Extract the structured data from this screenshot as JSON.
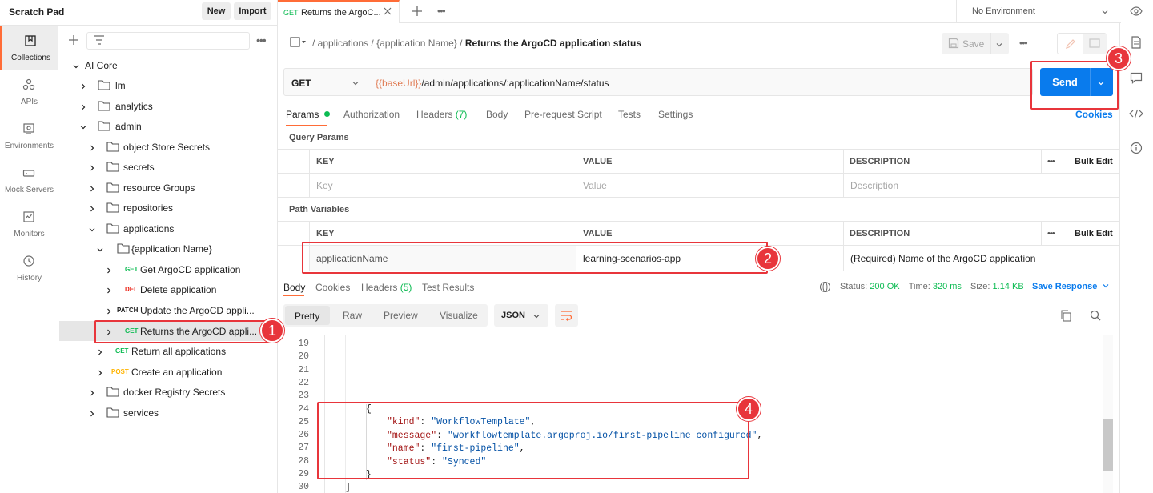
{
  "sidebar_header": {
    "title": "Scratch Pad",
    "new_label": "New",
    "import_label": "Import"
  },
  "rail": [
    {
      "label": "Collections",
      "icon": "collections-icon",
      "active": true
    },
    {
      "label": "APIs",
      "icon": "apis-icon"
    },
    {
      "label": "Environments",
      "icon": "environments-icon"
    },
    {
      "label": "Mock Servers",
      "icon": "mock-servers-icon"
    },
    {
      "label": "Monitors",
      "icon": "monitors-icon"
    },
    {
      "label": "History",
      "icon": "history-icon"
    }
  ],
  "tree": {
    "root": "AI Core",
    "items": [
      {
        "label": "lm"
      },
      {
        "label": "analytics"
      },
      {
        "label": "admin"
      },
      {
        "label": "object Store Secrets"
      },
      {
        "label": "secrets"
      },
      {
        "label": "resource Groups"
      },
      {
        "label": "repositories"
      },
      {
        "label": "applications"
      },
      {
        "label": "{application Name}"
      },
      {
        "method": "GET",
        "label": "Get ArgoCD application"
      },
      {
        "method": "DEL",
        "label": "Delete application"
      },
      {
        "method": "PATCH",
        "label": "Update the ArgoCD appli..."
      },
      {
        "method": "GET",
        "label": "Returns the ArgoCD appli..."
      },
      {
        "method": "GET",
        "label": "Return all applications"
      },
      {
        "method": "POST",
        "label": "Create an application"
      },
      {
        "label": "docker Registry Secrets"
      },
      {
        "label": "services"
      }
    ]
  },
  "tab": {
    "method": "GET",
    "title": "Returns the ArgoC..."
  },
  "environment": "No Environment",
  "breadcrumb": {
    "part1": "applications",
    "part2": "{application Name}",
    "current": "Returns the ArgoCD application status"
  },
  "save_label": "Save",
  "request": {
    "method": "GET",
    "url_var": "{{baseUrl}}",
    "url_rest": "/admin/applications/:applicationName/status",
    "send_label": "Send"
  },
  "req_tabs": {
    "params": "Params",
    "authorization": "Authorization",
    "headers": "Headers",
    "headers_count": "(7)",
    "body": "Body",
    "prerequest": "Pre-request Script",
    "tests": "Tests",
    "settings": "Settings",
    "cookies": "Cookies"
  },
  "query_params": {
    "title": "Query Params",
    "col_key": "KEY",
    "col_value": "VALUE",
    "col_desc": "DESCRIPTION",
    "bulk_edit": "Bulk Edit",
    "ph_key": "Key",
    "ph_value": "Value",
    "ph_desc": "Description"
  },
  "path_vars": {
    "title": "Path Variables",
    "col_key": "KEY",
    "col_value": "VALUE",
    "col_desc": "DESCRIPTION",
    "bulk_edit": "Bulk Edit",
    "key": "applicationName",
    "value": "learning-scenarios-app",
    "desc": "(Required) Name of the ArgoCD application"
  },
  "response": {
    "tabs": {
      "body": "Body",
      "cookies": "Cookies",
      "headers": "Headers",
      "headers_count": "(5)",
      "test_results": "Test Results"
    },
    "status_label": "Status:",
    "status": "200 OK",
    "time_label": "Time:",
    "time": "320 ms",
    "size_label": "Size:",
    "size": "1.14 KB",
    "save_response": "Save Response",
    "views": {
      "pretty": "Pretty",
      "raw": "Raw",
      "preview": "Preview",
      "visualize": "Visualize"
    },
    "format": "JSON"
  },
  "code": {
    "lines": [
      "19",
      "20",
      "21",
      "22",
      "23",
      "24",
      "25",
      "26",
      "27",
      "28",
      "29",
      "30"
    ],
    "kind_key": "\"kind\"",
    "kind_val": "\"WorkflowTemplate\"",
    "message_key": "\"message\"",
    "message_val_a": "\"workflowtemplate.argoproj.io",
    "message_link": "/first-pipeline",
    "message_val_b": " configured\"",
    "name_key": "\"name\"",
    "name_val": "\"first-pipeline\"",
    "status_key": "\"status\"",
    "status_val": "\"Synced\""
  },
  "callouts": [
    "1",
    "2",
    "3",
    "4"
  ],
  "colors": {
    "accent": "#ff6c37",
    "send": "#097bed",
    "annotation": "#e8353b"
  }
}
